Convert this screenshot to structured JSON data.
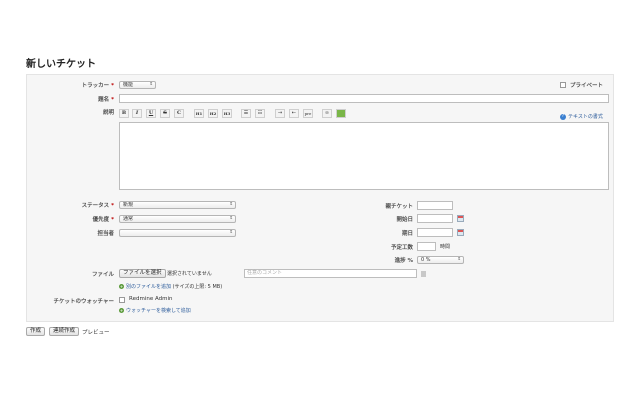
{
  "page": {
    "title": "新しいチケット"
  },
  "form": {
    "tracker": {
      "label": "トラッカー",
      "value": "機能"
    },
    "private": {
      "label": "プライベート"
    },
    "subject": {
      "label": "題名"
    },
    "description": {
      "label": "説明",
      "toolbar": [
        "B",
        "I",
        "U",
        "S",
        "C",
        "H1",
        "H2",
        "H3",
        "ul",
        "ol",
        "indent",
        "outdent",
        "pre",
        "link",
        "img"
      ],
      "text_format_link": "テキストの書式"
    },
    "status": {
      "label": "ステータス",
      "value": "新規"
    },
    "priority": {
      "label": "優先度",
      "value": "通常"
    },
    "assignee": {
      "label": "担当者",
      "value": ""
    },
    "parent_task": {
      "label": "親チケット"
    },
    "start_date": {
      "label": "開始日"
    },
    "due_date": {
      "label": "期日"
    },
    "estimated_time": {
      "label": "予定工数",
      "unit": "時間"
    },
    "done_ratio": {
      "label": "進捗 %",
      "value": "0 %"
    },
    "files": {
      "label": "ファイル",
      "choose_button": "ファイルを選択",
      "no_file": "選択されていません",
      "comment_placeholder": "任意のコメント",
      "add_another": "別のファイルを追加",
      "max_size": "(サイズの上限: 5 MB)"
    },
    "watchers": {
      "label": "チケットのウォッチャー",
      "user": "Redmine Admin",
      "search_link": "ウォッチャーを検索して追加"
    }
  },
  "actions": {
    "create": "作成",
    "create_continue": "連続作成",
    "preview": "プレビュー"
  }
}
